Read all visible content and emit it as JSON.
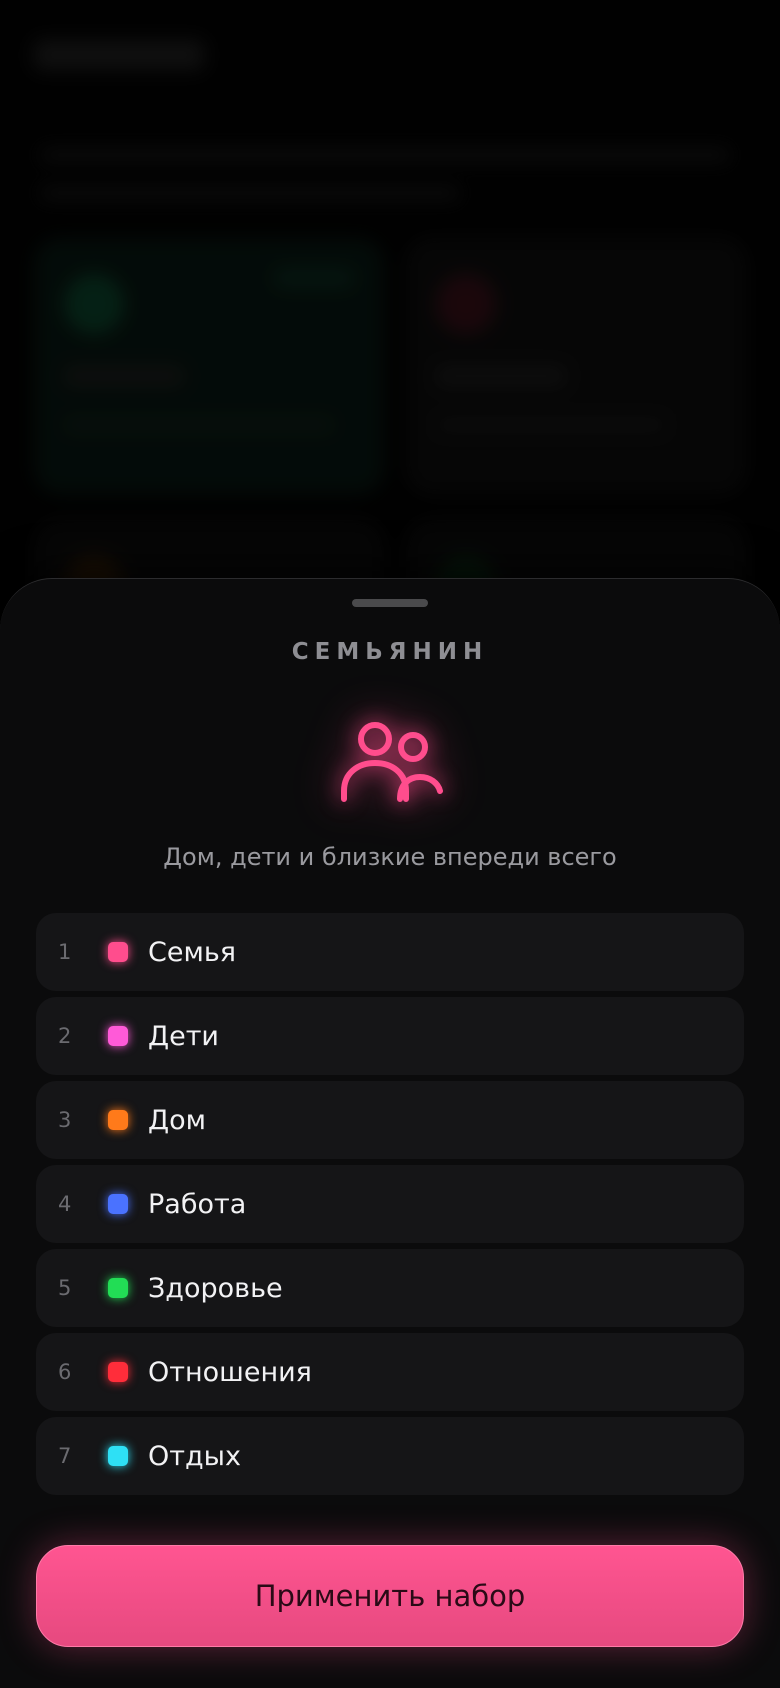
{
  "sheet": {
    "title": "СЕМЬЯНИН",
    "icon": "family-people-icon",
    "subtitle": "Дом, дети и близкие впереди всего",
    "accent_color": "#ff4d8d"
  },
  "items": [
    {
      "num": "1",
      "label": "Семья",
      "color": "#ff4d8d"
    },
    {
      "num": "2",
      "label": "Дети",
      "color": "#ff5ad8"
    },
    {
      "num": "3",
      "label": "Дом",
      "color": "#ff7a1a"
    },
    {
      "num": "4",
      "label": "Работа",
      "color": "#4a72ff"
    },
    {
      "num": "5",
      "label": "Здоровье",
      "color": "#22dd55"
    },
    {
      "num": "6",
      "label": "Отношения",
      "color": "#ff2d3a"
    },
    {
      "num": "7",
      "label": "Отдых",
      "color": "#2ee0f5"
    }
  ],
  "actions": {
    "apply_label": "Применить набор"
  }
}
